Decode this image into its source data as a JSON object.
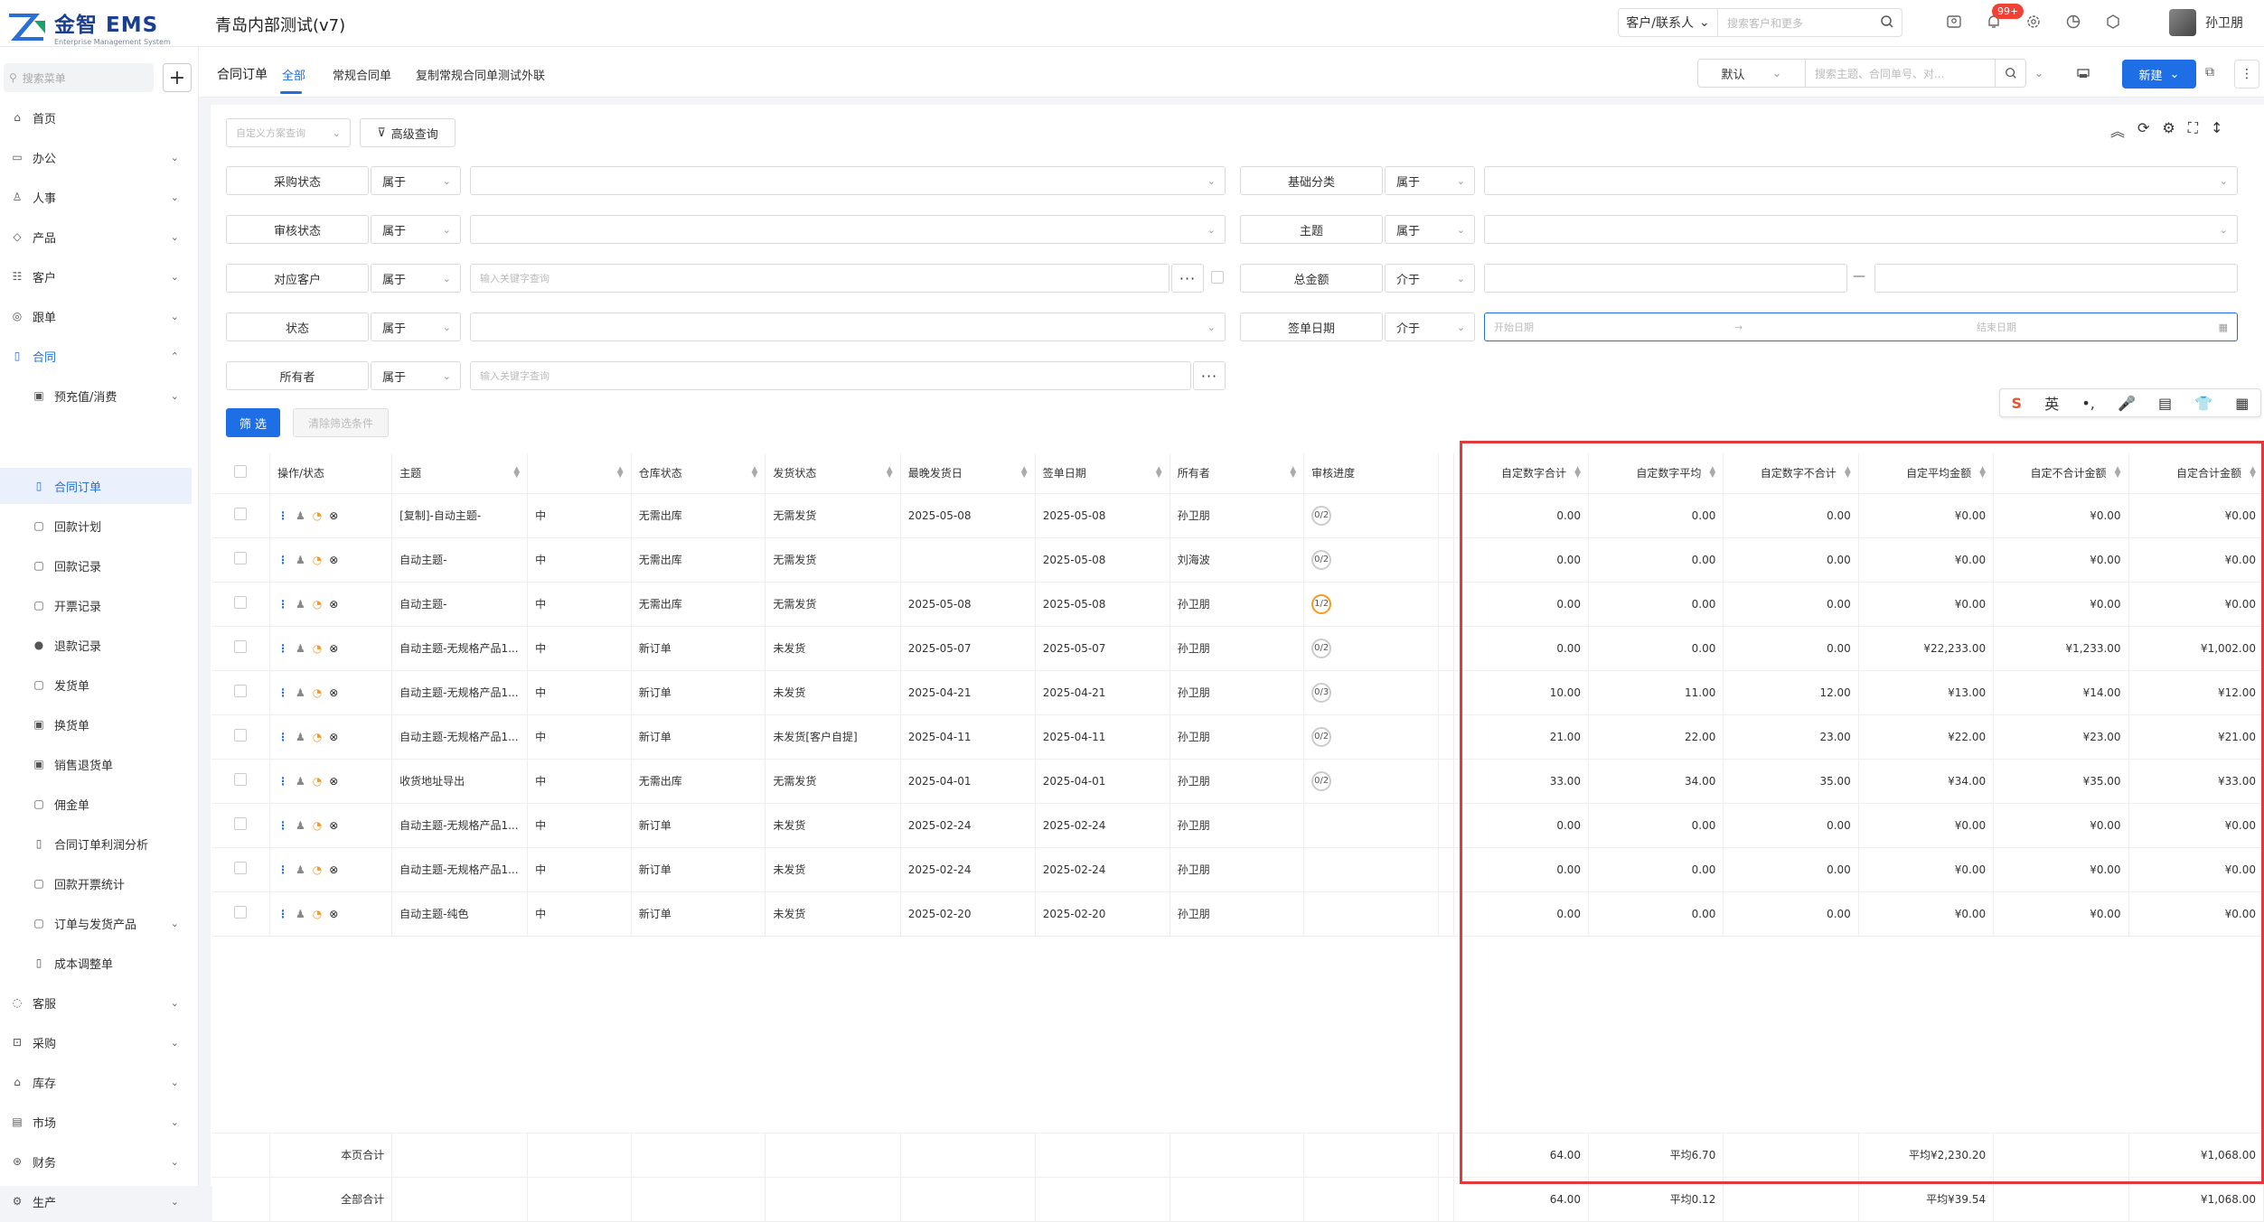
{
  "app": {
    "logo_title": "金智 EMS",
    "logo_subtitle": "Enterprise Management System",
    "title": "青岛内部测试(v7)",
    "search_scope": "客户/联系人",
    "search_placeholder": "搜索客户和更多",
    "notification_count": "99+",
    "user_name": "孙卫朋"
  },
  "sidebar": {
    "search_placeholder": "搜索菜单",
    "add_label": "+",
    "items": [
      {
        "label": "首页",
        "icon": "home-icon"
      },
      {
        "label": "办公",
        "icon": "office-icon"
      },
      {
        "label": "人事",
        "icon": "person-icon"
      },
      {
        "label": "产品",
        "icon": "product-icon"
      },
      {
        "label": "客户",
        "icon": "customer-icon"
      },
      {
        "label": "跟单",
        "icon": "follow-icon"
      },
      {
        "label": "合同",
        "icon": "contract-icon"
      },
      {
        "label": "预充值/消费",
        "icon": "prepay-icon"
      },
      {
        "label": "合同订单",
        "icon": "order-icon"
      },
      {
        "label": "回款计划",
        "icon": "plan-icon"
      },
      {
        "label": "回款记录",
        "icon": "record-icon"
      },
      {
        "label": "开票记录",
        "icon": "invoice-icon"
      },
      {
        "label": "退款记录",
        "icon": "refund-icon"
      },
      {
        "label": "发货单",
        "icon": "ship-icon"
      },
      {
        "label": "换货单",
        "icon": "exchange-icon"
      },
      {
        "label": "销售退货单",
        "icon": "return-icon"
      },
      {
        "label": "佣金单",
        "icon": "commission-icon"
      },
      {
        "label": "合同订单利润分析",
        "icon": "profit-icon"
      },
      {
        "label": "回款开票统计",
        "icon": "stats-icon"
      },
      {
        "label": "订单与发货产品",
        "icon": "orderprod-icon"
      },
      {
        "label": "成本调整单",
        "icon": "cost-icon"
      },
      {
        "label": "客服",
        "icon": "service-icon"
      },
      {
        "label": "采购",
        "icon": "purchase-icon"
      },
      {
        "label": "库存",
        "icon": "stock-icon"
      },
      {
        "label": "市场",
        "icon": "market-icon"
      },
      {
        "label": "财务",
        "icon": "finance-icon"
      },
      {
        "label": "生产",
        "icon": "production-icon"
      }
    ]
  },
  "tabs": {
    "title": "合同订单",
    "items": [
      "全部",
      "常规合同单",
      "复制常规合同单测试外联"
    ],
    "view_select": "默认",
    "search_placeholder": "搜索主题、合同单号、对...",
    "new_label": "新建"
  },
  "filters": {
    "custom_query_placeholder": "自定义方案查询",
    "advanced_label": "高级查询",
    "fields": [
      {
        "label": "采购状态",
        "op": "属于",
        "value": ""
      },
      {
        "label": "审核状态",
        "op": "属于",
        "value": ""
      },
      {
        "label": "对应客户",
        "op": "属于",
        "value": "输入关键字查询"
      },
      {
        "label": "状态",
        "op": "属于",
        "value": ""
      },
      {
        "label": "所有者",
        "op": "属于",
        "value": "输入关键字查询"
      },
      {
        "label": "基础分类",
        "op": "属于",
        "value": ""
      },
      {
        "label": "主题",
        "op": "属于",
        "value": ""
      },
      {
        "label": "总金额",
        "op": "介于",
        "value": ""
      },
      {
        "label": "签单日期",
        "op": "介于",
        "value": ""
      }
    ],
    "dots": "···",
    "dash": "—",
    "date_start": "开始日期",
    "date_arrow": "→",
    "date_end": "结束日期",
    "filter_btn": "筛 选",
    "clear_btn": "清除筛选条件"
  },
  "ime_toolbar": {
    "items": [
      "S",
      "英",
      "•,",
      "🎤",
      "▤",
      "👕",
      "▦"
    ]
  },
  "table": {
    "headers": [
      "操作/状态",
      "主题",
      "",
      "仓库状态",
      "发货状态",
      "最晚发货日",
      "签单日期",
      "所有者",
      "审核进度",
      "",
      "自定数字合计",
      "自定数字平均",
      "自定数字不合计",
      "自定平均金额",
      "自定不合计金额",
      "自定合计金额"
    ],
    "rows": [
      {
        "subject": "[复制]-自动主题-",
        "wh": "无需出库",
        "ship": "无需发货",
        "ship_c": "green",
        "latest": "2025-05-08",
        "sign": "2025-05-08",
        "owner": "孙卫朋",
        "prog": "0/2",
        "n1": "0.00",
        "n2": "0.00",
        "n3": "0.00",
        "a1": "¥0.00",
        "a2": "¥0.00",
        "a3": "¥0.00"
      },
      {
        "subject": "自动主题-",
        "wh": "无需出库",
        "ship": "无需发货",
        "ship_c": "green",
        "latest": "",
        "sign": "2025-05-08",
        "owner": "刘海波",
        "prog": "0/2",
        "n1": "0.00",
        "n2": "0.00",
        "n3": "0.00",
        "a1": "¥0.00",
        "a2": "¥0.00",
        "a3": "¥0.00"
      },
      {
        "subject": "自动主题-",
        "wh": "无需出库",
        "ship": "无需发货",
        "ship_c": "green",
        "latest": "2025-05-08",
        "sign": "2025-05-08",
        "owner": "孙卫朋",
        "prog": "1/2",
        "n1": "0.00",
        "n2": "0.00",
        "n3": "0.00",
        "a1": "¥0.00",
        "a2": "¥0.00",
        "a3": "¥0.00"
      },
      {
        "subject": "自动主题-无规格产品1...",
        "wh": "新订单",
        "ship": "未发货",
        "ship_c": "red",
        "latest": "2025-05-07",
        "sign": "2025-05-07",
        "owner": "孙卫朋",
        "prog": "0/2",
        "n1": "0.00",
        "n2": "0.00",
        "n3": "0.00",
        "a1": "¥22,233.00",
        "a2": "¥1,233.00",
        "a3": "¥1,002.00"
      },
      {
        "subject": "自动主题-无规格产品1...",
        "wh": "新订单",
        "ship": "未发货",
        "ship_c": "red",
        "latest": "2025-04-21",
        "sign": "2025-04-21",
        "owner": "孙卫朋",
        "prog": "0/3",
        "n1": "10.00",
        "n2": "11.00",
        "n3": "12.00",
        "a1": "¥13.00",
        "a2": "¥14.00",
        "a3": "¥12.00"
      },
      {
        "subject": "自动主题-无规格产品1...",
        "wh": "新订单",
        "ship": "未发货[客户自提]",
        "ship_c": "red",
        "latest": "2025-04-11",
        "sign": "2025-04-11",
        "owner": "孙卫朋",
        "prog": "0/2",
        "n1": "21.00",
        "n2": "22.00",
        "n3": "23.00",
        "a1": "¥22.00",
        "a2": "¥23.00",
        "a3": "¥21.00"
      },
      {
        "subject": "收货地址导出",
        "wh": "无需出库",
        "ship": "无需发货",
        "ship_c": "green",
        "latest": "2025-04-01",
        "sign": "2025-04-01",
        "owner": "孙卫朋",
        "prog": "0/2",
        "n1": "33.00",
        "n2": "34.00",
        "n3": "35.00",
        "a1": "¥34.00",
        "a2": "¥35.00",
        "a3": "¥33.00"
      },
      {
        "subject": "自动主题-无规格产品1...",
        "wh": "新订单",
        "ship": "未发货",
        "ship_c": "red",
        "latest": "2025-02-24",
        "sign": "2025-02-24",
        "owner": "孙卫朋",
        "prog": "",
        "n1": "0.00",
        "n2": "0.00",
        "n3": "0.00",
        "a1": "¥0.00",
        "a2": "¥0.00",
        "a3": "¥0.00"
      },
      {
        "subject": "自动主题-无规格产品1...",
        "wh": "新订单",
        "ship": "未发货",
        "ship_c": "red",
        "latest": "2025-02-24",
        "sign": "2025-02-24",
        "owner": "孙卫朋",
        "prog": "",
        "n1": "0.00",
        "n2": "0.00",
        "n3": "0.00",
        "a1": "¥0.00",
        "a2": "¥0.00",
        "a3": "¥0.00"
      },
      {
        "subject": "自动主题-纯色",
        "wh": "新订单",
        "ship": "未发货",
        "ship_c": "red",
        "latest": "2025-02-20",
        "sign": "2025-02-20",
        "owner": "孙卫朋",
        "prog": "",
        "n1": "0.00",
        "n2": "0.00",
        "n3": "0.00",
        "a1": "¥0.00",
        "a2": "¥0.00",
        "a3": "¥0.00"
      }
    ],
    "page_total": {
      "label": "本页合计",
      "n1": "64.00",
      "n2": "平均6.70",
      "a1": "平均¥2,230.20",
      "a3": "¥1,068.00"
    },
    "all_total": {
      "label": "全部合计",
      "n1": "64.00",
      "n2": "平均0.12",
      "a1": "平均¥39.54",
      "a3": "¥1,068.00"
    }
  },
  "colors": {
    "accent": "#1e6fe6",
    "highlight_box": "#e03a3a",
    "green": "#3cb14a",
    "red": "#e84545"
  }
}
